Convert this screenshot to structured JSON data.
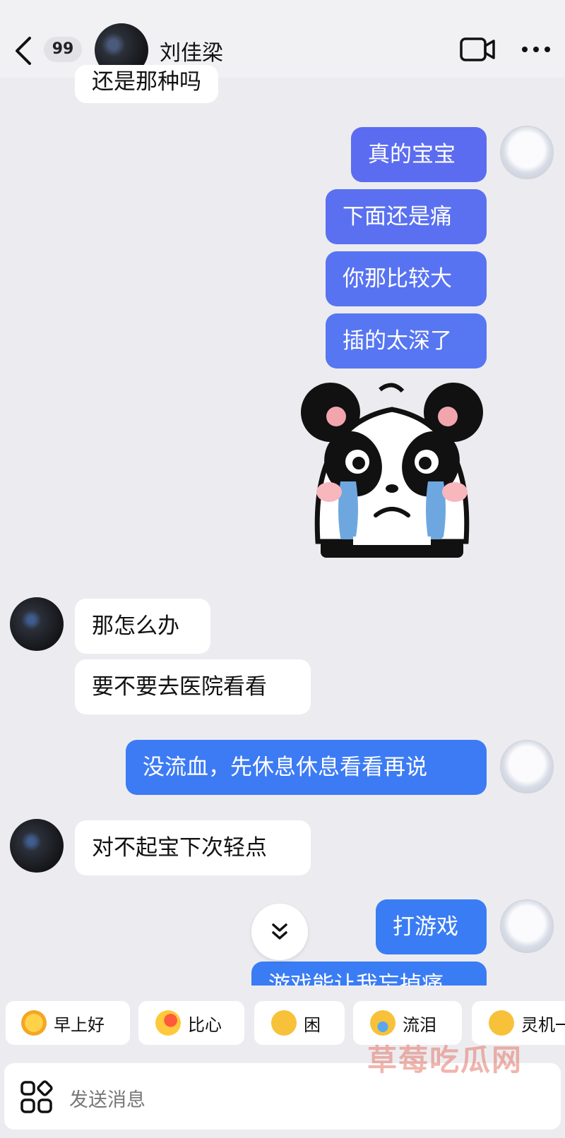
{
  "header": {
    "badge": "99",
    "contact_name": "刘佳梁"
  },
  "messages": {
    "partial_top": "还是那种吗",
    "m1": "真的宝宝",
    "m2": "下面还是痛",
    "m3": "你那比较大",
    "m4": "插的太深了",
    "m5": "那怎么办",
    "m6": "要不要去医院看看",
    "m7": "没流血，先休息休息看看再说",
    "m8": "对不起宝下次轻点",
    "m9": "打游戏",
    "m10_partial": "游戏能让我忘掉痛"
  },
  "quick_replies": [
    {
      "label": "早上好",
      "icon": "sun-emoji-icon"
    },
    {
      "label": "比心",
      "icon": "heart-hand-emoji-icon"
    },
    {
      "label": "困",
      "icon": "sleepy-emoji-icon"
    },
    {
      "label": "流泪",
      "icon": "crying-emoji-icon"
    },
    {
      "label": "灵机一动",
      "icon": "idea-emoji-icon"
    }
  ],
  "composer": {
    "placeholder": "发送消息"
  },
  "watermark": "草莓吃瓜网",
  "colors": {
    "accent_purple": "#5b6cf0",
    "accent_blue": "#3d7bf4",
    "chat_bg": "#ececf0"
  }
}
